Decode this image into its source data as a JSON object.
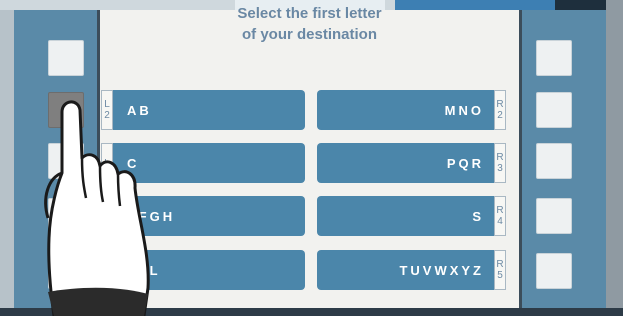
{
  "screen": {
    "title_line1": "Select the first letter",
    "title_line2": "of your destination"
  },
  "left_options": [
    {
      "key": "L2",
      "tag_letter": "L",
      "tag_number": "2",
      "label": "AB"
    },
    {
      "key": "L3",
      "tag_letter": "L",
      "tag_number": "",
      "label": "C"
    },
    {
      "key": "L4",
      "tag_letter": "",
      "tag_number": "",
      "label": "EFGH"
    },
    {
      "key": "L5",
      "tag_letter": "",
      "tag_number": "",
      "label": "JKL"
    }
  ],
  "right_options": [
    {
      "key": "R2",
      "tag_letter": "R",
      "tag_number": "2",
      "label": "MNO"
    },
    {
      "key": "R3",
      "tag_letter": "R",
      "tag_number": "3",
      "label": "PQR"
    },
    {
      "key": "R4",
      "tag_letter": "R",
      "tag_number": "4",
      "label": "S"
    },
    {
      "key": "R5",
      "tag_letter": "R",
      "tag_number": "5",
      "label": "TUVWXYZ"
    }
  ],
  "pressed_button": "L2",
  "colors": {
    "option_fill": "#4b86aa",
    "bezel": "#5a8aa8",
    "title_text": "#6a88a4",
    "screen_bg": "#f2f2ef"
  }
}
